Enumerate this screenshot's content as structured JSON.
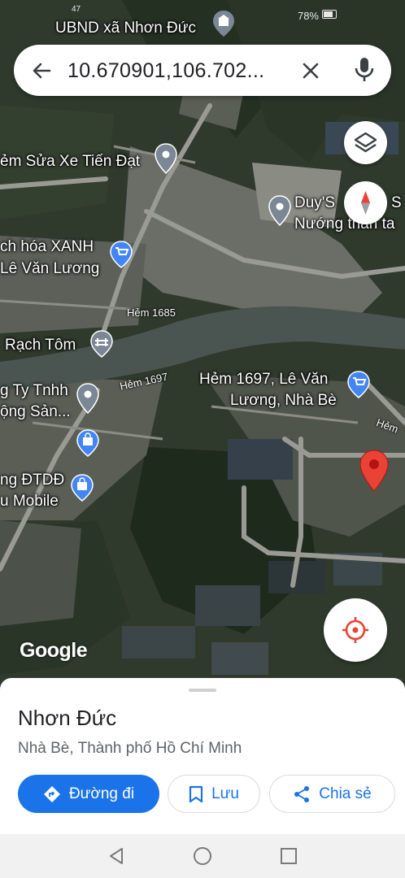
{
  "status_bar": {
    "battery_percent": "78%",
    "corner_text": "47"
  },
  "search": {
    "query": "10.670901,106.702...",
    "back_icon": "arrow-left-icon",
    "clear_icon": "close-icon",
    "mic_icon": "microphone-icon"
  },
  "map_controls": {
    "layers_icon": "layers-icon",
    "compass_icon": "compass-icon",
    "locate_icon": "my-location-icon",
    "watermark": "Google"
  },
  "map_labels": {
    "ubnd": "UBND xã Nhơn Đức",
    "hem_sua_xe": "ẻm Sửa Xe Tiến Đạt",
    "duys_line1": "Duy'S",
    "duys_line1b": "S",
    "duys_line2": "Nướng than ta",
    "bach_hoa_line1": "ch hóa XANH",
    "bach_hoa_line2": "Lê Văn Lương",
    "hem1685": "Hẻm 1685",
    "rach_tom": "Rạch Tôm",
    "cong_ty_line1": "g Ty Tnhh",
    "cong_ty_line2": "ộng Sản...",
    "hem1697_road": "Hẻm 1697",
    "hem1697_line1": "Hẻm 1697, Lê Văn",
    "hem1697_line2": "Lương, Nhà Bè",
    "hem_right": "Hẻm",
    "dtdd_line1": "ng ĐTDĐ",
    "dtdd_line2": "u Mobile"
  },
  "place": {
    "name": "Nhơn Đức",
    "address": "Nhà Bè, Thành phố Hồ Chí Minh",
    "directions_label": "Đường đi",
    "save_label": "Lưu",
    "share_label": "Chia sẻ"
  },
  "colors": {
    "accent": "#1a73e8",
    "pin": "#ea4335",
    "river": "#4a5552"
  }
}
